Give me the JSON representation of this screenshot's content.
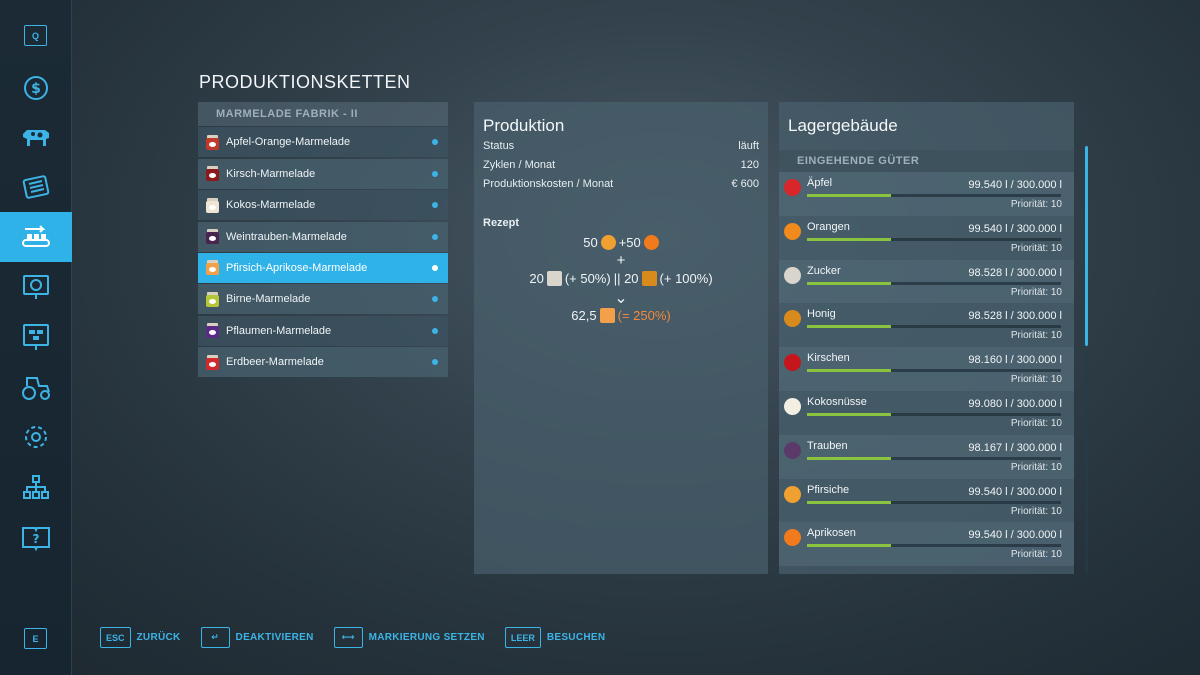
{
  "sidebar": {
    "top_key": "Q",
    "bottom_key": "E",
    "items": [
      {
        "icon": "dollar-icon",
        "active": false
      },
      {
        "icon": "cow-icon",
        "active": false
      },
      {
        "icon": "newspaper-icon",
        "active": false
      },
      {
        "icon": "production-chain-icon",
        "active": true
      },
      {
        "icon": "presentation-icon",
        "active": false
      },
      {
        "icon": "board-icon",
        "active": false
      },
      {
        "icon": "tractor-icon",
        "active": false
      },
      {
        "icon": "gear-icon",
        "active": false
      },
      {
        "icon": "network-icon",
        "active": false
      },
      {
        "icon": "help-book-icon",
        "active": false
      }
    ]
  },
  "page_title": "PRODUKTIONSKETTEN",
  "chains": {
    "header": "MARMELADE FABRIK   - II",
    "items": [
      {
        "label": "Apfel-Orange-Marmelade",
        "jar_color": "#c0392b"
      },
      {
        "label": "Kirsch-Marmelade",
        "jar_color": "#8b1a1a"
      },
      {
        "label": "Kokos-Marmelade",
        "jar_color": "#eee6d2"
      },
      {
        "label": "Weintrauben-Marmelade",
        "jar_color": "#4a2450"
      },
      {
        "label": "Pfirsich-Aprikose-Marmelade",
        "jar_color": "#f4a04a"
      },
      {
        "label": "Birne-Marmelade",
        "jar_color": "#b5c63a"
      },
      {
        "label": "Pflaumen-Marmelade",
        "jar_color": "#5b2a86"
      },
      {
        "label": "Erdbeer-Marmelade",
        "jar_color": "#d02a2a"
      }
    ],
    "selected_index": 4
  },
  "production": {
    "title": "Produktion",
    "rows": [
      {
        "key": "Status",
        "value": "läuft"
      },
      {
        "key": "Zyklen / Monat",
        "value": "120"
      },
      {
        "key": "Produktionskosten / Monat",
        "value": "€ 600"
      }
    ],
    "recipe_title": "Rezept",
    "line1_a": "50",
    "line1_b": "+50",
    "plus": "+",
    "line2_a": "20",
    "line2_b": "(+ 50%)",
    "line2_sep": "|| 20",
    "line2_c": "(+ 100%)",
    "arrow": "⌄",
    "result_amount": "62,5",
    "result_pct": "(= 250%)"
  },
  "storage": {
    "title": "Lagergebäude",
    "section": "EINGEHENDE GÜTER",
    "goods": [
      {
        "name": "Äpfel",
        "amount": "99.540 l / 300.000 l",
        "priority": "Priorität: 10",
        "fill": 0.33,
        "icon": "apple-icon",
        "color": "#d8262b"
      },
      {
        "name": "Orangen",
        "amount": "99.540 l / 300.000 l",
        "priority": "Priorität: 10",
        "fill": 0.33,
        "icon": "orange-icon",
        "color": "#f08a1c"
      },
      {
        "name": "Zucker",
        "amount": "98.528 l / 300.000 l",
        "priority": "Priorität: 10",
        "fill": 0.33,
        "icon": "sugar-icon",
        "color": "#d9d4cc"
      },
      {
        "name": "Honig",
        "amount": "98.528 l / 300.000 l",
        "priority": "Priorität: 10",
        "fill": 0.33,
        "icon": "honey-icon",
        "color": "#d98a1c"
      },
      {
        "name": "Kirschen",
        "amount": "98.160 l / 300.000 l",
        "priority": "Priorität: 10",
        "fill": 0.33,
        "icon": "cherry-icon",
        "color": "#c4161c"
      },
      {
        "name": "Kokosnüsse",
        "amount": "99.080 l / 300.000 l",
        "priority": "Priorität: 10",
        "fill": 0.33,
        "icon": "coconut-icon",
        "color": "#f3eee2"
      },
      {
        "name": "Trauben",
        "amount": "98.167 l / 300.000 l",
        "priority": "Priorität: 10",
        "fill": 0.33,
        "icon": "grape-icon",
        "color": "#5b3a6a"
      },
      {
        "name": "Pfirsiche",
        "amount": "99.540 l / 300.000 l",
        "priority": "Priorität: 10",
        "fill": 0.33,
        "icon": "peach-icon",
        "color": "#f0a030"
      },
      {
        "name": "Aprikosen",
        "amount": "99.540 l / 300.000 l",
        "priority": "Priorität: 10",
        "fill": 0.33,
        "icon": "apricot-icon",
        "color": "#f07a1c"
      }
    ]
  },
  "footer": [
    {
      "key": "ESC",
      "label": "ZURÜCK"
    },
    {
      "key": "↵",
      "label": "DEAKTIVIEREN"
    },
    {
      "key": "⟷",
      "label": "MARKIERUNG SETZEN"
    },
    {
      "key": "LEER",
      "label": "BESUCHEN"
    }
  ],
  "colors": {
    "accent": "#2fb2e8",
    "bar_fill": "#8ac43f",
    "highlight_orange": "#f08a3c"
  }
}
